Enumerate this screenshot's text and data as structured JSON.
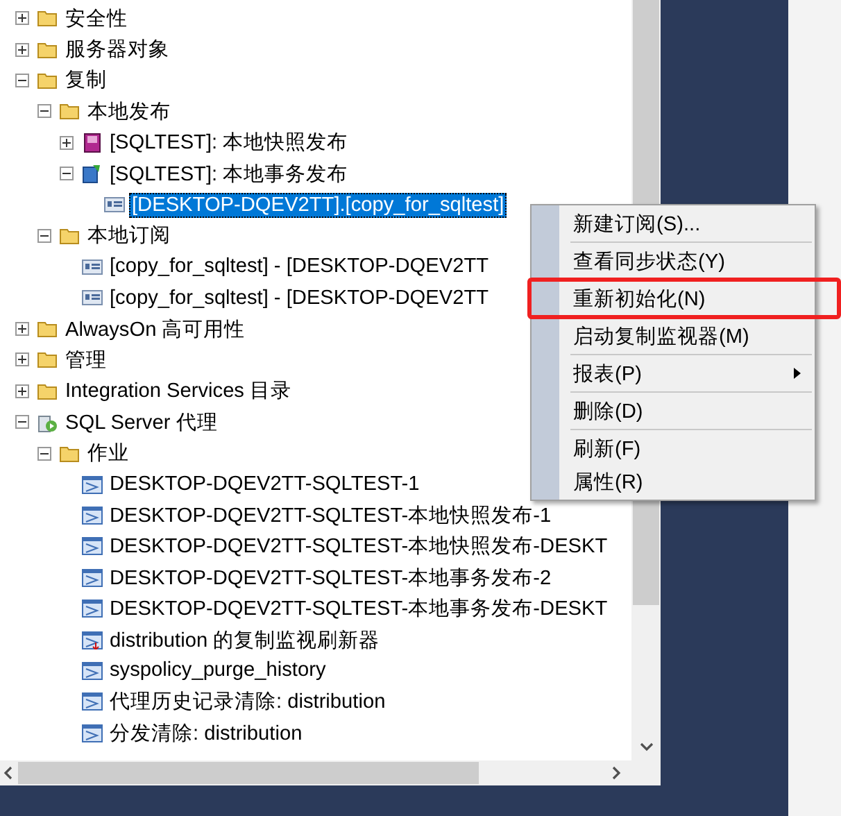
{
  "tree": [
    {
      "label": "安全性",
      "kind": "folder",
      "expanded": false
    },
    {
      "label": "服务器对象",
      "kind": "folder",
      "expanded": false
    },
    {
      "label": "复制",
      "kind": "folder",
      "expanded": true,
      "children": [
        {
          "label": "本地发布",
          "kind": "folder",
          "expanded": true,
          "children": [
            {
              "label": "[SQLTEST]: 本地快照发布",
              "kind": "snapshot_publication",
              "expanded": false
            },
            {
              "label": "[SQLTEST]: 本地事务发布",
              "kind": "transactional_publication",
              "expanded": true,
              "children": [
                {
                  "label": "[DESKTOP-DQEV2TT].[copy_for_sqltest]",
                  "kind": "subscription",
                  "selected": true
                }
              ]
            }
          ]
        },
        {
          "label": "本地订阅",
          "kind": "folder",
          "expanded": true,
          "children": [
            {
              "label": "[copy_for_sqltest] - [DESKTOP-DQEV2TT",
              "kind": "subscription",
              "selected": false
            },
            {
              "label": "[copy_for_sqltest] - [DESKTOP-DQEV2TT",
              "kind": "subscription",
              "selected": false
            }
          ]
        }
      ]
    },
    {
      "label": "AlwaysOn 高可用性",
      "kind": "folder",
      "expanded": false
    },
    {
      "label": "管理",
      "kind": "folder",
      "expanded": false
    },
    {
      "label": "Integration Services 目录",
      "kind": "folder",
      "expanded": false
    },
    {
      "label": "SQL Server 代理",
      "kind": "agent",
      "expanded": true,
      "children": [
        {
          "label": "作业",
          "kind": "folder",
          "expanded": true,
          "children": [
            {
              "label": "DESKTOP-DQEV2TT-SQLTEST-1",
              "kind": "job"
            },
            {
              "label": "DESKTOP-DQEV2TT-SQLTEST-本地快照发布-1",
              "kind": "job"
            },
            {
              "label": "DESKTOP-DQEV2TT-SQLTEST-本地快照发布-DESKT",
              "kind": "job"
            },
            {
              "label": "DESKTOP-DQEV2TT-SQLTEST-本地事务发布-2",
              "kind": "job"
            },
            {
              "label": "DESKTOP-DQEV2TT-SQLTEST-本地事务发布-DESKT",
              "kind": "job"
            },
            {
              "label": "distribution 的复制监视刷新器",
              "kind": "job_alert"
            },
            {
              "label": "syspolicy_purge_history",
              "kind": "job"
            },
            {
              "label": "代理历史记录清除: distribution",
              "kind": "job"
            },
            {
              "label": "分发清除: distribution",
              "kind": "job"
            }
          ]
        }
      ]
    }
  ],
  "context_menu": {
    "items": [
      {
        "kind": "item",
        "label": "新建订阅(S)..."
      },
      {
        "kind": "separator"
      },
      {
        "kind": "item",
        "label": "查看同步状态(Y)"
      },
      {
        "kind": "item",
        "label": "重新初始化(N)",
        "highlighted": true
      },
      {
        "kind": "item",
        "label": "启动复制监视器(M)"
      },
      {
        "kind": "separator"
      },
      {
        "kind": "item",
        "label": "报表(P)",
        "submenu": true
      },
      {
        "kind": "separator"
      },
      {
        "kind": "item",
        "label": "删除(D)"
      },
      {
        "kind": "separator"
      },
      {
        "kind": "item",
        "label": "刷新(F)"
      },
      {
        "kind": "item",
        "label": "属性(R)"
      }
    ]
  }
}
